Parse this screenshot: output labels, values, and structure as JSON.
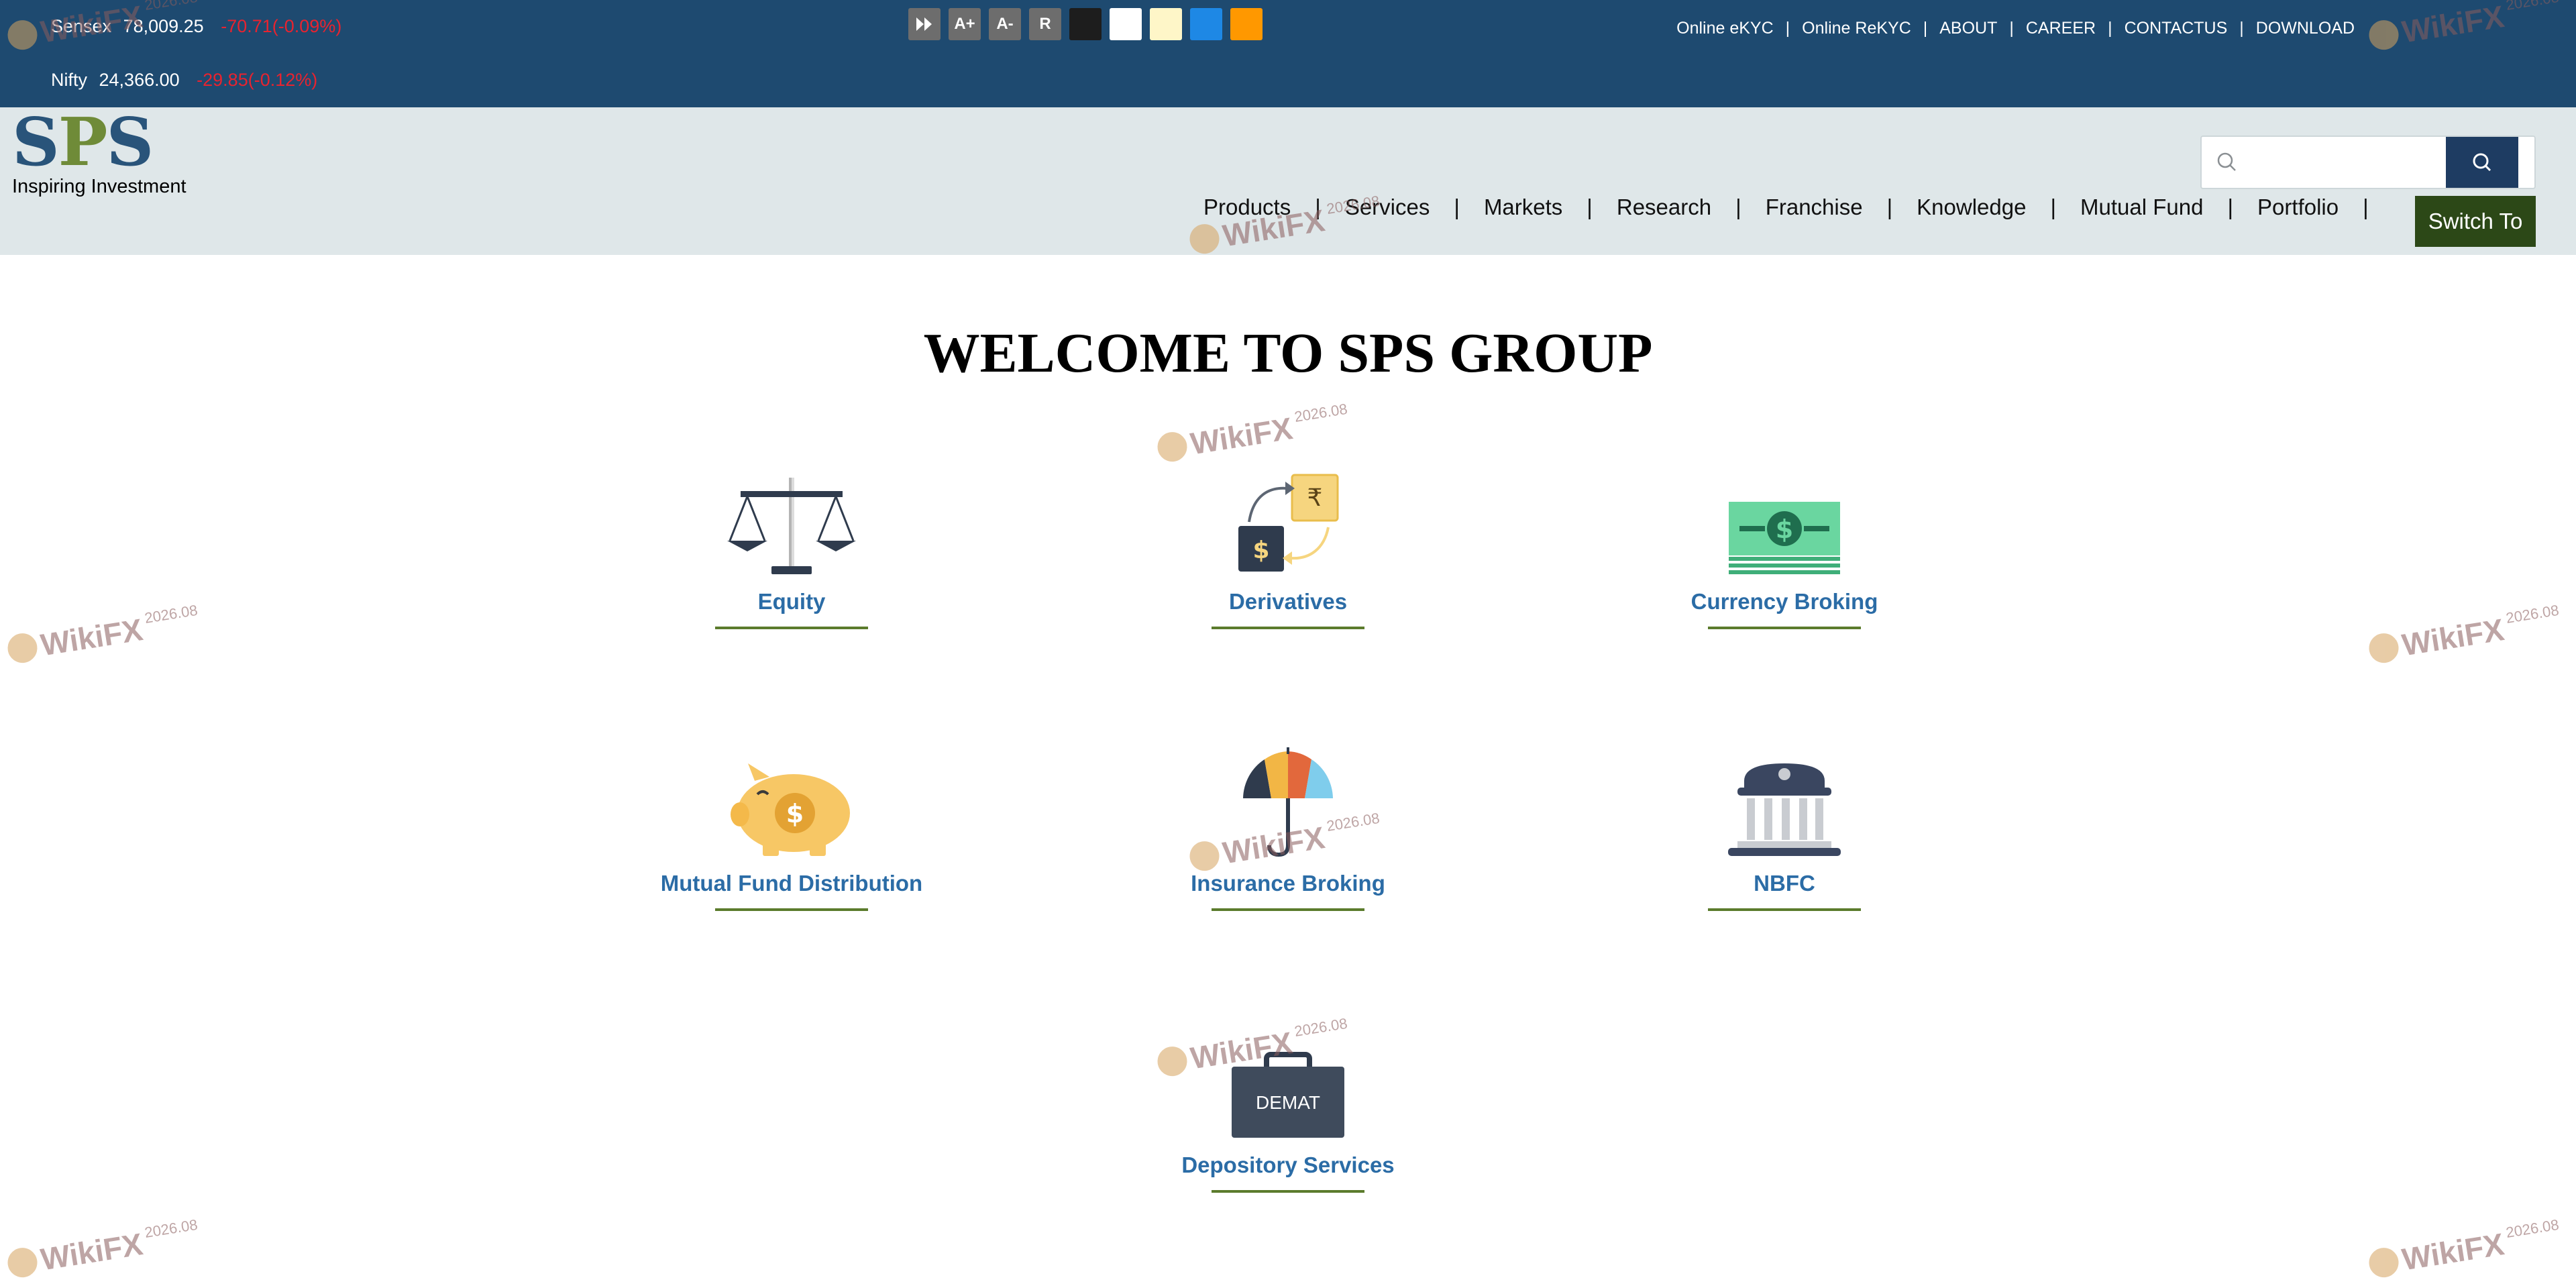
{
  "ticker": {
    "sensex": {
      "label": "Sensex",
      "value": "78,009.25",
      "change": "-70.71(-0.09%)"
    },
    "nifty": {
      "label": "Nifty",
      "value": "24,366.00",
      "change": "-29.85(-0.12%)"
    }
  },
  "tools": {
    "skip_icon": "fast-forward-icon",
    "font_increase": "A+",
    "font_decrease": "A-",
    "reset": "R",
    "swatches": [
      "#1d1d1d",
      "#ffffff",
      "#fef6c8",
      "#1e88e5",
      "#ff9800"
    ]
  },
  "toplinks": [
    "Online eKYC",
    "Online ReKYC",
    "ABOUT",
    "CAREER",
    "CONTACTUS",
    "DOWNLOAD"
  ],
  "logo": {
    "s1": "S",
    "p": "P",
    "s2": "S",
    "tagline": "Inspiring Investment"
  },
  "search": {
    "placeholder": ""
  },
  "nav": [
    "Products",
    "Services",
    "Markets",
    "Research",
    "Franchise",
    "Knowledge",
    "Mutual Fund",
    "Portfolio"
  ],
  "switch_label": "Switch To",
  "welcome": "WELCOME TO SPS GROUP",
  "services": [
    {
      "title": "Equity",
      "icon": "scale-icon"
    },
    {
      "title": "Derivatives",
      "icon": "currency-exchange-icon"
    },
    {
      "title": "Currency Broking",
      "icon": "banknote-icon"
    },
    {
      "title": "Mutual Fund Distribution",
      "icon": "piggy-bank-icon"
    },
    {
      "title": "Insurance Broking",
      "icon": "umbrella-icon"
    },
    {
      "title": "NBFC",
      "icon": "bank-building-icon"
    },
    {
      "title": "Depository Services",
      "icon": "briefcase-icon",
      "icon_text": "DEMAT"
    }
  ],
  "watermark": {
    "text": "WikiFX",
    "year": "2026.08"
  },
  "colors": {
    "topbar": "#1e4a70",
    "header": "#dfe7e9",
    "switch": "#2c4817",
    "link": "#2b6ca6",
    "accent_line": "#5b7b2c",
    "negative": "#e8232f"
  }
}
